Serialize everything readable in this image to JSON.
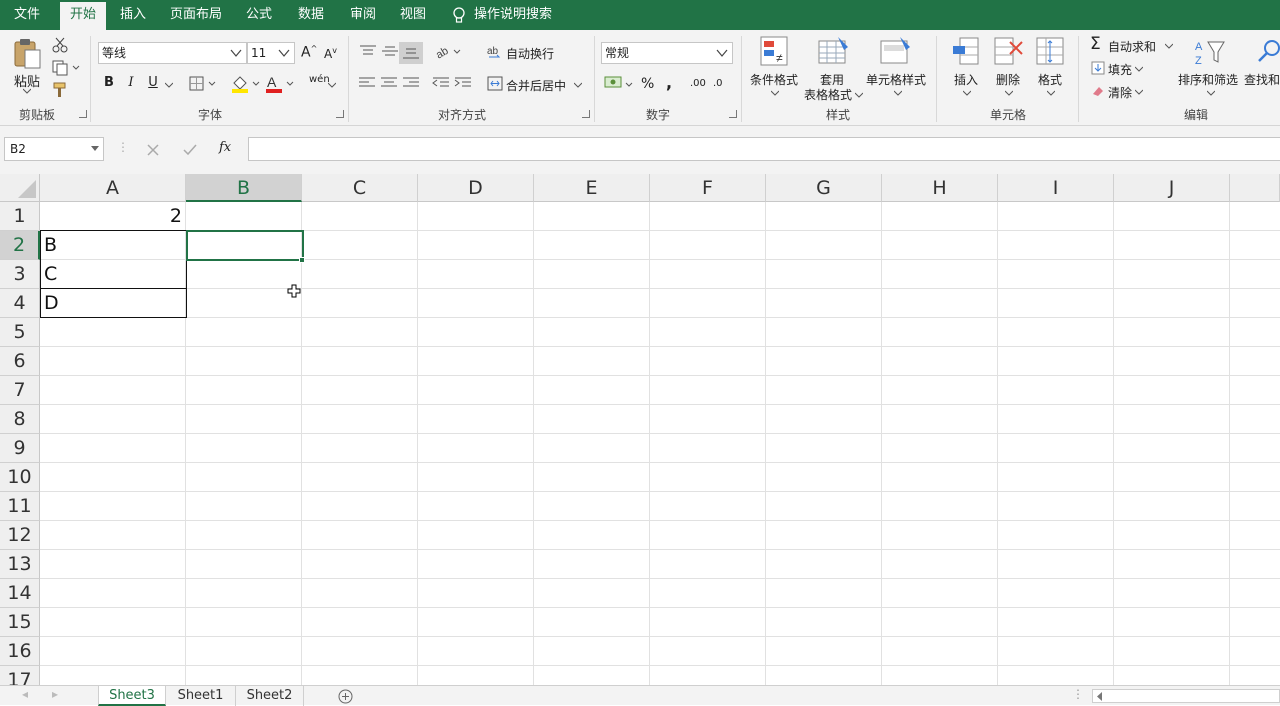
{
  "menu": {
    "tabs": [
      "文件",
      "开始",
      "插入",
      "页面布局",
      "公式",
      "数据",
      "审阅",
      "视图"
    ],
    "tell_me": "操作说明搜索"
  },
  "ribbon": {
    "clipboard": {
      "paste": "粘贴",
      "group": "剪贴板"
    },
    "font": {
      "name": "等线",
      "size": "11",
      "bold": "B",
      "italic": "I",
      "underline": "U",
      "phonetic": "wén",
      "group": "字体"
    },
    "alignment": {
      "wrap": "自动换行",
      "merge": "合并后居中",
      "group": "对齐方式"
    },
    "number": {
      "format": "常规",
      "percent": "%",
      "comma": ",",
      "inc_decimal": ".00",
      "dec_decimal": ".0",
      "group": "数字"
    },
    "styles": {
      "conditional": "条件格式",
      "table_line1": "套用",
      "table_line2": "表格格式",
      "cell_styles": "单元格样式",
      "group": "样式"
    },
    "cells": {
      "insert": "插入",
      "delete": "删除",
      "format": "格式",
      "group": "单元格"
    },
    "editing": {
      "autosum": "自动求和",
      "fill": "填充",
      "clear": "清除",
      "sort": "排序和筛选",
      "find": "查找和",
      "group": "编辑"
    }
  },
  "formula_bar": {
    "name_box": "B2",
    "value": "",
    "fx": "fx"
  },
  "grid": {
    "columns": [
      "A",
      "B",
      "C",
      "D",
      "E",
      "F",
      "G",
      "H",
      "I",
      "J"
    ],
    "rows": [
      "1",
      "2",
      "3",
      "4",
      "5",
      "6",
      "7",
      "8",
      "9",
      "10",
      "11",
      "12",
      "13",
      "14",
      "15",
      "16",
      "17"
    ],
    "cells": {
      "A1": "2",
      "A2": "B",
      "A3": "C",
      "A4": "D"
    },
    "selected": "B2"
  },
  "sheets": {
    "tabs": [
      "Sheet3",
      "Sheet1",
      "Sheet2"
    ],
    "active": "Sheet3"
  },
  "colors": {
    "accent": "#217346",
    "ribbon_bg": "#f3f3f3",
    "gridline": "#e1e1e1"
  }
}
